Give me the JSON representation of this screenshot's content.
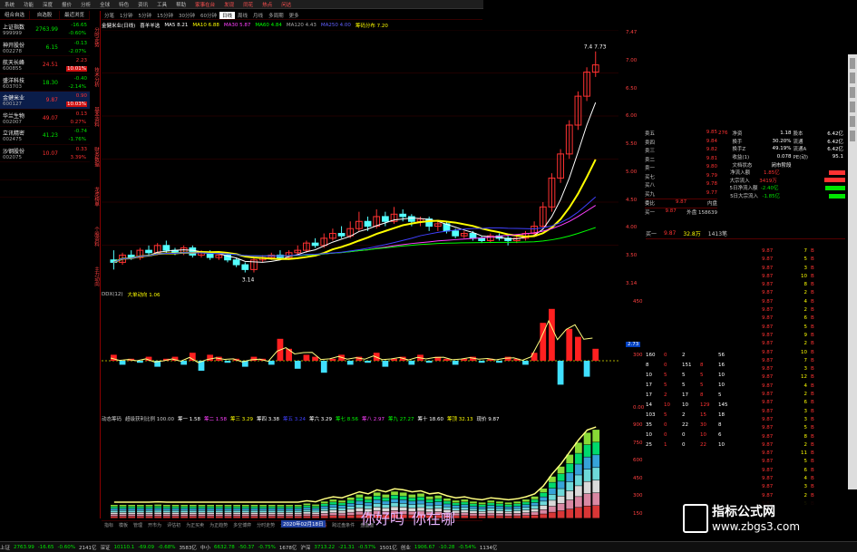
{
  "menu": [
    "系统",
    "功能",
    "深度",
    "报价",
    "分析",
    "全球",
    "特色",
    "资讯",
    "工具",
    "帮助",
    "家事在台",
    "发现",
    "同花",
    "热点",
    "问达"
  ],
  "watchlist": {
    "headers": [
      "组合自选",
      "自选股",
      "最近浏览"
    ],
    "rows": [
      {
        "name": "上证指数",
        "code": "999999",
        "price": "2763.99",
        "chg": "-16.65",
        "pct": "-0.60%",
        "dir": "dn"
      },
      {
        "name": "神开股份",
        "code": "002278",
        "price": "6.15",
        "chg": "-0.13",
        "pct": "-2.07%",
        "dir": "dn"
      },
      {
        "name": "航天长峰",
        "code": "600855",
        "price": "24.51",
        "chg": "2.23",
        "pct": "10.01%",
        "dir": "up",
        "badge": true
      },
      {
        "name": "盛洋科技",
        "code": "603703",
        "price": "18.30",
        "chg": "-0.40",
        "pct": "-2.14%",
        "dir": "dn"
      },
      {
        "name": "金健米业",
        "code": "600127",
        "price": "9.87",
        "chg": "0.90",
        "pct": "10.03%",
        "dir": "up",
        "badge": true,
        "sel": true
      },
      {
        "name": "华兰生物",
        "code": "002007",
        "price": "49.07",
        "chg": "0.13",
        "pct": "0.27%",
        "dir": "up"
      },
      {
        "name": "立讯精密",
        "code": "002475",
        "price": "41.23",
        "chg": "-0.74",
        "pct": "-1.76%",
        "dir": "dn"
      },
      {
        "name": "沙钢股份",
        "code": "002075",
        "price": "10.07",
        "chg": "0.33",
        "pct": "3.39%",
        "dir": "up"
      },
      {
        "name": "",
        "code": "",
        "price": "",
        "chg": "",
        "pct": "",
        "dir": "dn"
      },
      {
        "name": "",
        "code": "",
        "price": "",
        "chg": "",
        "pct": "",
        "dir": "dn"
      }
    ]
  },
  "vtabs": [
    "分时走势",
    "技术分析",
    "基本资料",
    "财务数据",
    "龙虎榜单",
    "个股资料",
    "主力动向"
  ],
  "timeframes": [
    "分笔",
    "1分钟",
    "5分钟",
    "15分钟",
    "30分钟",
    "60分钟",
    "日线",
    "周线",
    "月线",
    "多周期",
    "更多"
  ],
  "active_tf": "日线",
  "ma": {
    "title": "金健米业(日线)",
    "items": [
      {
        "t": "喜羊羊选",
        "c": "#ffffff"
      },
      {
        "t": "MA5 8.21",
        "c": "#ffffff"
      },
      {
        "t": "MA10 6.88",
        "c": "#ffff00"
      },
      {
        "t": "MA30 5.87",
        "c": "#ff40ff"
      },
      {
        "t": "MA60 4.84",
        "c": "#00ff00"
      },
      {
        "t": "MA120 4.43",
        "c": "#aaaaaa"
      },
      {
        "t": "MA250 4.00",
        "c": "#6060ff"
      },
      {
        "t": "筹码分布 7.20",
        "c": "#ffff00"
      }
    ]
  },
  "price_labels": {
    "high": "7.4",
    "high2": "7.73",
    "low": "3.14"
  },
  "sub1": {
    "items": [
      {
        "t": "DDX(12)",
        "c": "#cccccc"
      },
      {
        "t": "大单动向 1.06",
        "c": "#ffff00"
      }
    ],
    "box": "2.73"
  },
  "sub2": {
    "items": [
      {
        "t": "动态筹码",
        "c": "#ccc"
      },
      {
        "t": "超级获利比例 100.00",
        "c": "#ccc"
      },
      {
        "t": "筹一 1.58",
        "c": "#ffffff"
      },
      {
        "t": "筹二 1.58",
        "c": "#ff40ff"
      },
      {
        "t": "筹三 3.29",
        "c": "#ffff00"
      },
      {
        "t": "筹四 3.38",
        "c": "#ffffff"
      },
      {
        "t": "筹五 3.24",
        "c": "#4040ff"
      },
      {
        "t": "筹六 3.29",
        "c": "#ffffff"
      },
      {
        "t": "筹七 8.56",
        "c": "#00ff00"
      },
      {
        "t": "筹八 2.97",
        "c": "#ff40ff"
      },
      {
        "t": "筹九 27.27",
        "c": "#00ff00"
      },
      {
        "t": "筹十 18.60",
        "c": "#ffffff"
      },
      {
        "t": "筹顶 32.13",
        "c": "#ffff00"
      },
      {
        "t": "现价 9.87",
        "c": "#ffffff"
      }
    ]
  },
  "btabs": [
    "指标",
    "模板",
    "管理",
    "开市为",
    "评估初",
    "为正买卖",
    "为正趋势",
    "多空博弈",
    "分时走势",
    "分析级表弦",
    "动态筹码",
    "跨过盘条件",
    "盘面面"
  ],
  "date_box": "2020年02月18日",
  "overlay": [
    "你好吗",
    "你在哪"
  ],
  "rp_sell": [
    [
      "卖五",
      "9.85",
      ""
    ],
    [
      "卖四",
      "9.84",
      ""
    ],
    [
      "卖三",
      "9.82",
      ""
    ],
    [
      "卖二",
      "9.81",
      ""
    ],
    [
      "卖一",
      "9.80",
      ""
    ],
    [
      "买七",
      "9.79",
      ""
    ],
    [
      "买八",
      "9.78",
      ""
    ],
    [
      "买九",
      "9.77",
      ""
    ]
  ],
  "rp_bottom": [
    [
      "委比",
      "9.87",
      "内盘"
    ],
    [
      "买一",
      "9.87",
      "外盘 158639"
    ]
  ],
  "fin": [
    [
      "276",
      "净资",
      "1.18",
      "股本",
      "6.42亿"
    ],
    [
      "",
      "换手",
      "30.20%",
      "流通",
      "6.42亿"
    ],
    [
      "",
      "换手Z",
      "49.19%",
      "流通A",
      "6.42亿"
    ],
    [
      "",
      "收益(1)",
      "0.078",
      "PE(动)",
      "95.1"
    ],
    [
      "",
      "文档状态",
      "闭市阶段",
      "",
      ""
    ],
    [
      "",
      "净流入额",
      "1.85亿",
      "",
      ""
    ],
    [
      "",
      "大宗流入",
      "3419万",
      "",
      ""
    ],
    [
      "",
      "5日净流入额",
      "-2.40亿",
      "",
      ""
    ],
    [
      "",
      "5日大宗流入",
      "-1.85亿",
      "",
      ""
    ]
  ],
  "tick_head": [
    "买一",
    "9.87",
    "32.8万",
    "1413笔"
  ],
  "ticks": [
    "9.87",
    "9.87",
    "9.87",
    "9.87",
    "9.87",
    "9.87",
    "9.87",
    "9.87",
    "9.87",
    "9.87",
    "9.87",
    "9.87",
    "9.87",
    "9.87",
    "9.87",
    "9.87",
    "9.87",
    "9.87",
    "9.87",
    "9.87",
    "9.87",
    "9.87",
    "9.87",
    "9.87",
    "9.87",
    "9.87",
    "9.87",
    "9.87",
    "9.87",
    "9.87",
    "9.87"
  ],
  "tick_vols": [
    "7",
    "5",
    "3",
    "10",
    "8",
    "2",
    "4",
    "2",
    "6",
    "5",
    "9",
    "2",
    "10",
    "7",
    "3",
    "12",
    "4",
    "2",
    "6",
    "3",
    "3",
    "5",
    "8",
    "2",
    "11",
    "5",
    "6",
    "4",
    "3",
    "2",
    "5"
  ],
  "obook": [
    [
      "160",
      "0",
      "2",
      "",
      "56"
    ],
    [
      "8",
      "0",
      "151",
      "8",
      "16"
    ],
    [
      "10",
      "5",
      "5",
      "5",
      "10"
    ],
    [
      "17",
      "5",
      "5",
      "5",
      "10"
    ],
    [
      "17",
      "2",
      "17",
      "8",
      "5"
    ],
    [
      "14",
      "10",
      "10",
      "129",
      "145"
    ],
    [
      "103",
      "5",
      "2",
      "15",
      "18"
    ],
    [
      "35",
      "0",
      "22",
      "30",
      "8"
    ],
    [
      "10",
      "0",
      "0",
      "10",
      "6"
    ],
    [
      "25",
      "1",
      "0",
      "22",
      "10"
    ]
  ],
  "axis_main": [
    "7.47",
    "7.00",
    "6.50",
    "6.00",
    "5.50",
    "5.00",
    "4.50",
    "4.00",
    "3.50",
    "3.14"
  ],
  "axis_sub1": [
    "450",
    "300",
    "0.00"
  ],
  "axis_sub2": [
    "900",
    "750",
    "600",
    "450",
    "300",
    "150"
  ],
  "bottombar": [
    {
      "t": "上证",
      "c": "#ccc"
    },
    {
      "t": "2763.99",
      "c": "#00e600"
    },
    {
      "t": "-16.65",
      "c": "#00e600"
    },
    {
      "t": "-0.60%",
      "c": "#00e600"
    },
    {
      "t": "2141亿",
      "c": "#ccc"
    },
    {
      "t": "深证",
      "c": "#ccc"
    },
    {
      "t": "10110.1",
      "c": "#00e600"
    },
    {
      "t": "-69.09",
      "c": "#00e600"
    },
    {
      "t": "-0.68%",
      "c": "#00e600"
    },
    {
      "t": "3583亿",
      "c": "#ccc"
    },
    {
      "t": "中小",
      "c": "#ccc"
    },
    {
      "t": "6632.78",
      "c": "#00e600"
    },
    {
      "t": "-50.37",
      "c": "#00e600"
    },
    {
      "t": "-0.75%",
      "c": "#00e600"
    },
    {
      "t": "1678亿",
      "c": "#ccc"
    },
    {
      "t": "沪深",
      "c": "#ccc"
    },
    {
      "t": "3713.22",
      "c": "#00e600"
    },
    {
      "t": "-21.31",
      "c": "#00e600"
    },
    {
      "t": "-0.57%",
      "c": "#00e600"
    },
    {
      "t": "1501亿",
      "c": "#ccc"
    },
    {
      "t": "创业",
      "c": "#ccc"
    },
    {
      "t": "1906.67",
      "c": "#00e600"
    },
    {
      "t": "-10.28",
      "c": "#00e600"
    },
    {
      "t": "-0.54%",
      "c": "#00e600"
    },
    {
      "t": "1134亿",
      "c": "#ccc"
    }
  ],
  "logo": {
    "title": "指标公式网",
    "url": "www.zbgs3.com"
  },
  "colors": {
    "up": "#ff3232",
    "down": "#00e600",
    "ma5": "#ffffff",
    "ma10": "#ffff00",
    "ma30": "#ff40ff",
    "ma60": "#00ff00",
    "ma250": "#4040ff"
  },
  "candles": [
    [
      3.4,
      3.35,
      3.6,
      3.2
    ],
    [
      3.35,
      3.5,
      3.55,
      3.3
    ],
    [
      3.5,
      3.45,
      3.6,
      3.4
    ],
    [
      3.45,
      3.6,
      3.65,
      3.4
    ],
    [
      3.6,
      3.55,
      3.7,
      3.5
    ],
    [
      3.55,
      3.7,
      3.75,
      3.5
    ],
    [
      3.7,
      3.6,
      3.8,
      3.55
    ],
    [
      3.6,
      3.55,
      3.65,
      3.5
    ],
    [
      3.55,
      3.65,
      3.7,
      3.5
    ],
    [
      3.65,
      3.5,
      3.7,
      3.45
    ],
    [
      3.5,
      3.55,
      3.6,
      3.45
    ],
    [
      3.55,
      3.45,
      3.6,
      3.4
    ],
    [
      3.45,
      3.5,
      3.55,
      3.4
    ],
    [
      3.5,
      3.4,
      3.55,
      3.35
    ],
    [
      3.4,
      3.3,
      3.45,
      3.25
    ],
    [
      3.3,
      3.2,
      3.35,
      3.14
    ],
    [
      3.2,
      3.4,
      3.45,
      3.14
    ],
    [
      3.4,
      3.45,
      3.5,
      3.35
    ],
    [
      3.45,
      3.5,
      3.55,
      3.4
    ],
    [
      3.5,
      3.45,
      3.6,
      3.4
    ],
    [
      3.45,
      3.55,
      3.6,
      3.4
    ],
    [
      3.55,
      3.6,
      3.7,
      3.5
    ],
    [
      3.6,
      3.75,
      3.8,
      3.55
    ],
    [
      3.75,
      3.7,
      3.85,
      3.65
    ],
    [
      3.7,
      3.85,
      3.95,
      3.65
    ],
    [
      3.85,
      3.95,
      4.05,
      3.8
    ],
    [
      3.95,
      3.9,
      4.1,
      3.85
    ],
    [
      3.9,
      4.05,
      4.2,
      3.85
    ],
    [
      4.05,
      4.2,
      4.4,
      4.0
    ],
    [
      4.2,
      4.1,
      4.3,
      4.0
    ],
    [
      4.1,
      4.3,
      4.45,
      4.05
    ],
    [
      4.3,
      4.2,
      4.4,
      4.1
    ],
    [
      4.2,
      4.35,
      4.5,
      4.15
    ],
    [
      4.35,
      4.3,
      4.45,
      4.2
    ],
    [
      4.3,
      4.2,
      4.35,
      4.1
    ],
    [
      4.2,
      4.25,
      4.3,
      4.1
    ],
    [
      4.25,
      4.1,
      4.3,
      4.0
    ],
    [
      4.1,
      4.15,
      4.2,
      4.0
    ],
    [
      4.15,
      4.0,
      4.2,
      3.95
    ],
    [
      4.0,
      3.9,
      4.05,
      3.85
    ],
    [
      3.9,
      3.95,
      4.0,
      3.85
    ],
    [
      3.95,
      3.85,
      4.0,
      3.8
    ],
    [
      3.85,
      3.8,
      3.9,
      3.75
    ],
    [
      3.8,
      3.9,
      3.95,
      3.75
    ],
    [
      3.9,
      3.85,
      3.95,
      3.8
    ],
    [
      3.85,
      3.8,
      3.9,
      3.7
    ],
    [
      3.8,
      3.85,
      3.9,
      3.75
    ],
    [
      3.85,
      3.95,
      4.0,
      3.8
    ],
    [
      3.95,
      4.1,
      4.2,
      3.9
    ],
    [
      4.1,
      4.5,
      4.6,
      4.05
    ],
    [
      4.5,
      5.1,
      5.2,
      4.4
    ],
    [
      5.1,
      5.6,
      5.7,
      5.0
    ],
    [
      5.6,
      6.2,
      6.3,
      5.5
    ],
    [
      6.2,
      6.8,
      6.9,
      6.1
    ],
    [
      6.8,
      7.3,
      7.4,
      6.7
    ],
    [
      7.3,
      7.45,
      7.73,
      7.2
    ]
  ],
  "ddx": [
    0.3,
    -0.2,
    0.1,
    -0.1,
    0.2,
    -0.3,
    0.1,
    0.2,
    -0.2,
    0.4,
    -0.5,
    0.3,
    0.2,
    -0.1,
    0.1,
    -0.3,
    0.2,
    0.1,
    -0.2,
    1.1,
    0.6,
    -0.4,
    0.3,
    0.2,
    -0.6,
    0.1,
    0.3,
    -0.2,
    0.2,
    -0.1,
    0.4,
    -0.3,
    0.1,
    0.2,
    -0.2,
    0.3,
    -0.1,
    0.2,
    0.1,
    -0.2,
    0.1,
    0.2,
    -0.1,
    0.1,
    -0.1,
    0.2,
    0.1,
    -0.2,
    0.4,
    1.9,
    2.6,
    -1.2,
    1.6,
    1.2,
    -0.8,
    0.6
  ]
}
